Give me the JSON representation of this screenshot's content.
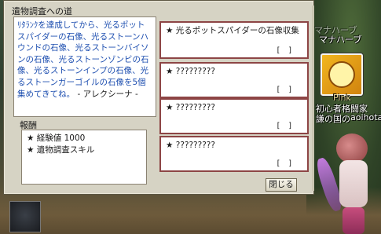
{
  "window": {
    "title": "遺物調査への道",
    "description": "ﾘﾀﾗﾝｸを達成してから、光るポットスパイダーの石像、光るストーンハウンドの石像、光るストーンバイソンの石像、光るストーンゾンビの石像、光るストーンインプの石像、光るストーンガーゴイルの石像を5個集めてきてね。",
    "signature": "- アレクシーナ -",
    "reward_title": "報酬",
    "rewards": [
      {
        "marker": "★",
        "label": "経験値 1000"
      },
      {
        "marker": "★",
        "label": "遺物調査スキル"
      }
    ],
    "close_label": "閉じる"
  },
  "quests": [
    {
      "marker": "★",
      "title": "光るポットスパイダーの石像収集",
      "count": "[ ]"
    },
    {
      "marker": "★",
      "title": "?????????",
      "count": "[ ]"
    },
    {
      "marker": "★",
      "title": "?????????",
      "count": "[ ]"
    },
    {
      "marker": "★",
      "title": "?????????",
      "count": "[ ]"
    }
  ],
  "overlay": {
    "skill_top_faint": "マナハーブ",
    "skill_top": "マナハーブ",
    "pet_name": "Pink",
    "player_line1": "初心者格闘家",
    "player_line2": "謙の国の",
    "player_name": "aoihotan"
  },
  "colors": {
    "window_bg": "#d6d3c4",
    "desc_text": "#1e4fb0",
    "card_border": "#8d4545"
  }
}
